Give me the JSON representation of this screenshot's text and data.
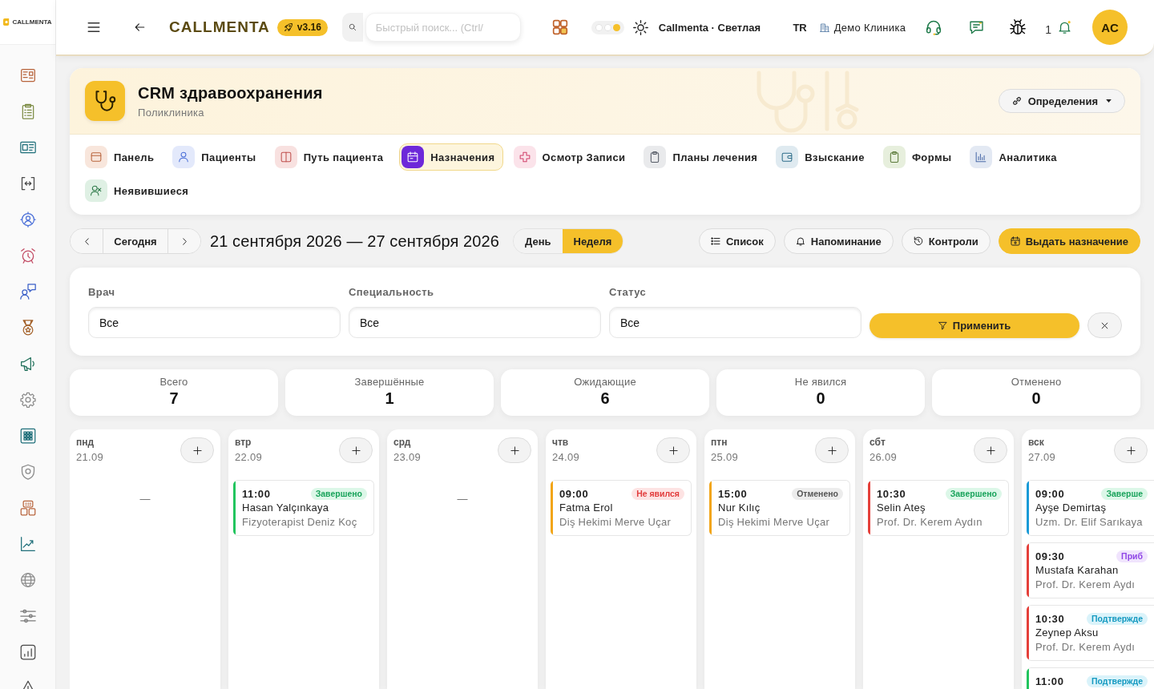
{
  "sidebar": {
    "logo_text": "CALLMENTA"
  },
  "topbar": {
    "brand": "CALLMENTA",
    "version": "v3.16",
    "search": {
      "placeholder": "Быстрый поиск... (Ctrl/"
    },
    "theme": {
      "modes": [
        {
          "selected": false
        },
        {
          "selected": false
        },
        {
          "selected": true
        }
      ],
      "name": "Callmenta · Светлая"
    },
    "language": "TR",
    "clinic": "Демо Клиника",
    "notification_count": "1",
    "avatar_initials": "AC"
  },
  "header": {
    "title": "CRM здравоохранения",
    "subtitle": "Поликлиника",
    "definitions_button": "Определения"
  },
  "tabs": [
    {
      "label": "Панель",
      "selected": false
    },
    {
      "label": "Пациенты",
      "selected": false
    },
    {
      "label": "Путь пациента",
      "selected": false
    },
    {
      "label": "Назначения",
      "selected": true
    },
    {
      "label": "Осмотр Записи",
      "selected": false
    },
    {
      "label": "Планы лечения",
      "selected": false
    },
    {
      "label": "Взыскание",
      "selected": false
    },
    {
      "label": "Формы",
      "selected": false
    },
    {
      "label": "Аналитика",
      "selected": false
    },
    {
      "label": "Неявившиеся",
      "selected": false
    }
  ],
  "toolbar": {
    "today_button": "Сегодня",
    "date_range": "21 сентября 2026 — 27 сентября 2026",
    "views": [
      {
        "label": "День",
        "selected": false
      },
      {
        "label": "Неделя",
        "selected": true
      }
    ],
    "actions": [
      {
        "label": "Список",
        "kind": "outline"
      },
      {
        "label": "Напоминание",
        "kind": "outline"
      },
      {
        "label": "Контроли",
        "kind": "outline"
      },
      {
        "label": "Выдать назначение",
        "kind": "primary"
      }
    ]
  },
  "filters": {
    "fields": [
      {
        "label": "Врач",
        "value": "Все"
      },
      {
        "label": "Специальность",
        "value": "Все"
      },
      {
        "label": "Статус",
        "value": "Все"
      }
    ],
    "apply_button": "Применить"
  },
  "stats": [
    {
      "label": "Всего",
      "value": "7"
    },
    {
      "label": "Завершённые",
      "value": "1"
    },
    {
      "label": "Ожидающие",
      "value": "6"
    },
    {
      "label": "Не явился",
      "value": "0"
    },
    {
      "label": "Отменено",
      "value": "0"
    }
  ],
  "calendar": {
    "days": [
      {
        "name": "пнд",
        "date": "21.09",
        "empty_text": "—"
      },
      {
        "name": "втр",
        "date": "22.09",
        "appointments": [
          {
            "time": "11:00",
            "status": "Завершено",
            "kind": "completed",
            "patient": "Hasan Yalçınkaya",
            "doctor": "Fizyoterapist Deniz Koç",
            "color": "#22c55e"
          }
        ]
      },
      {
        "name": "срд",
        "date": "23.09",
        "empty_text": "—"
      },
      {
        "name": "чтв",
        "date": "24.09",
        "appointments": [
          {
            "time": "09:00",
            "status": "Не явился",
            "kind": "no_show",
            "patient": "Fatma Erol",
            "doctor": "Diş Hekimi Merve Uçar",
            "color": "#f2a516"
          }
        ]
      },
      {
        "name": "птн",
        "date": "25.09",
        "appointments": [
          {
            "time": "15:00",
            "status": "Отменено",
            "kind": "cancelled",
            "patient": "Nur Kılıç",
            "doctor": "Diş Hekimi Merve Uçar",
            "color": "#f2a516"
          }
        ]
      },
      {
        "name": "сбт",
        "date": "26.09",
        "appointments": [
          {
            "time": "10:30",
            "status": "Завершено",
            "kind": "completed",
            "patient": "Selin Ateş",
            "doctor": "Prof. Dr. Kerem Aydın",
            "color": "#e5403a"
          }
        ]
      },
      {
        "name": "вск",
        "date": "27.09",
        "appointments": [
          {
            "time": "09:00",
            "status": "Заверше",
            "kind": "completed",
            "patient": "Ayşe Demirtaş",
            "doctor": "Uzm. Dr. Elif Sarıkaya",
            "color": "#1a9bd7"
          },
          {
            "time": "09:30",
            "status": "Приб",
            "kind": "arrived",
            "patient": "Mustafa Karahan",
            "doctor": "Prof. Dr. Kerem Aydı",
            "color": "#e5403a"
          },
          {
            "time": "10:30",
            "status": "Подтвержде",
            "kind": "confirmed",
            "patient": "Zeynep Aksu",
            "doctor": "Prof. Dr. Kerem Aydı",
            "color": "#e5403a"
          },
          {
            "time": "11:00",
            "status": "Подтвержде",
            "kind": "confirmed",
            "color": "#22c55e"
          }
        ]
      }
    ]
  }
}
